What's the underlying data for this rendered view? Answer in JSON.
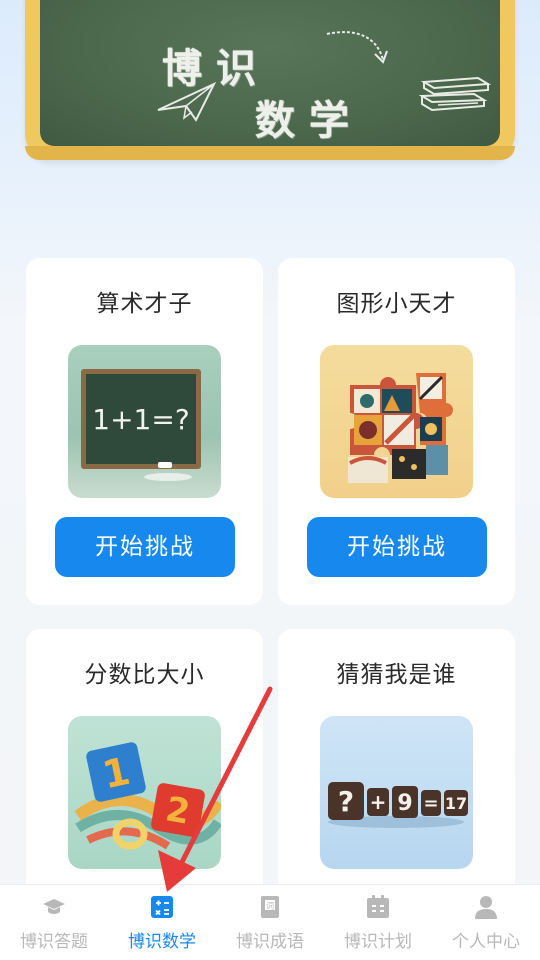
{
  "banner": {
    "line1": "博识",
    "line2": "数学"
  },
  "cards": [
    {
      "title": "算术才子",
      "button": "开始挑战",
      "image_text": "1+1=?"
    },
    {
      "title": "图形小天才",
      "button": "开始挑战"
    },
    {
      "title": "分数比大小",
      "image_digits": [
        "1",
        "2"
      ]
    },
    {
      "title": "猜猜我是谁",
      "image_tiles": [
        "?",
        "+",
        "9",
        "=",
        "17"
      ]
    }
  ],
  "tabbar": {
    "tabs": [
      {
        "label": "博识答题",
        "icon": "graduation-cap-icon",
        "active": false
      },
      {
        "label": "博识数学",
        "icon": "calculator-icon",
        "active": true
      },
      {
        "label": "博识成语",
        "icon": "dictionary-book-icon",
        "active": false
      },
      {
        "label": "博识计划",
        "icon": "calendar-icon",
        "active": false
      },
      {
        "label": "个人中心",
        "icon": "person-icon",
        "active": false
      }
    ]
  },
  "colors": {
    "accent": "#1789ee",
    "board": "#4b674c",
    "frame": "#f0c860",
    "annotation_arrow": "#e63b3b"
  }
}
